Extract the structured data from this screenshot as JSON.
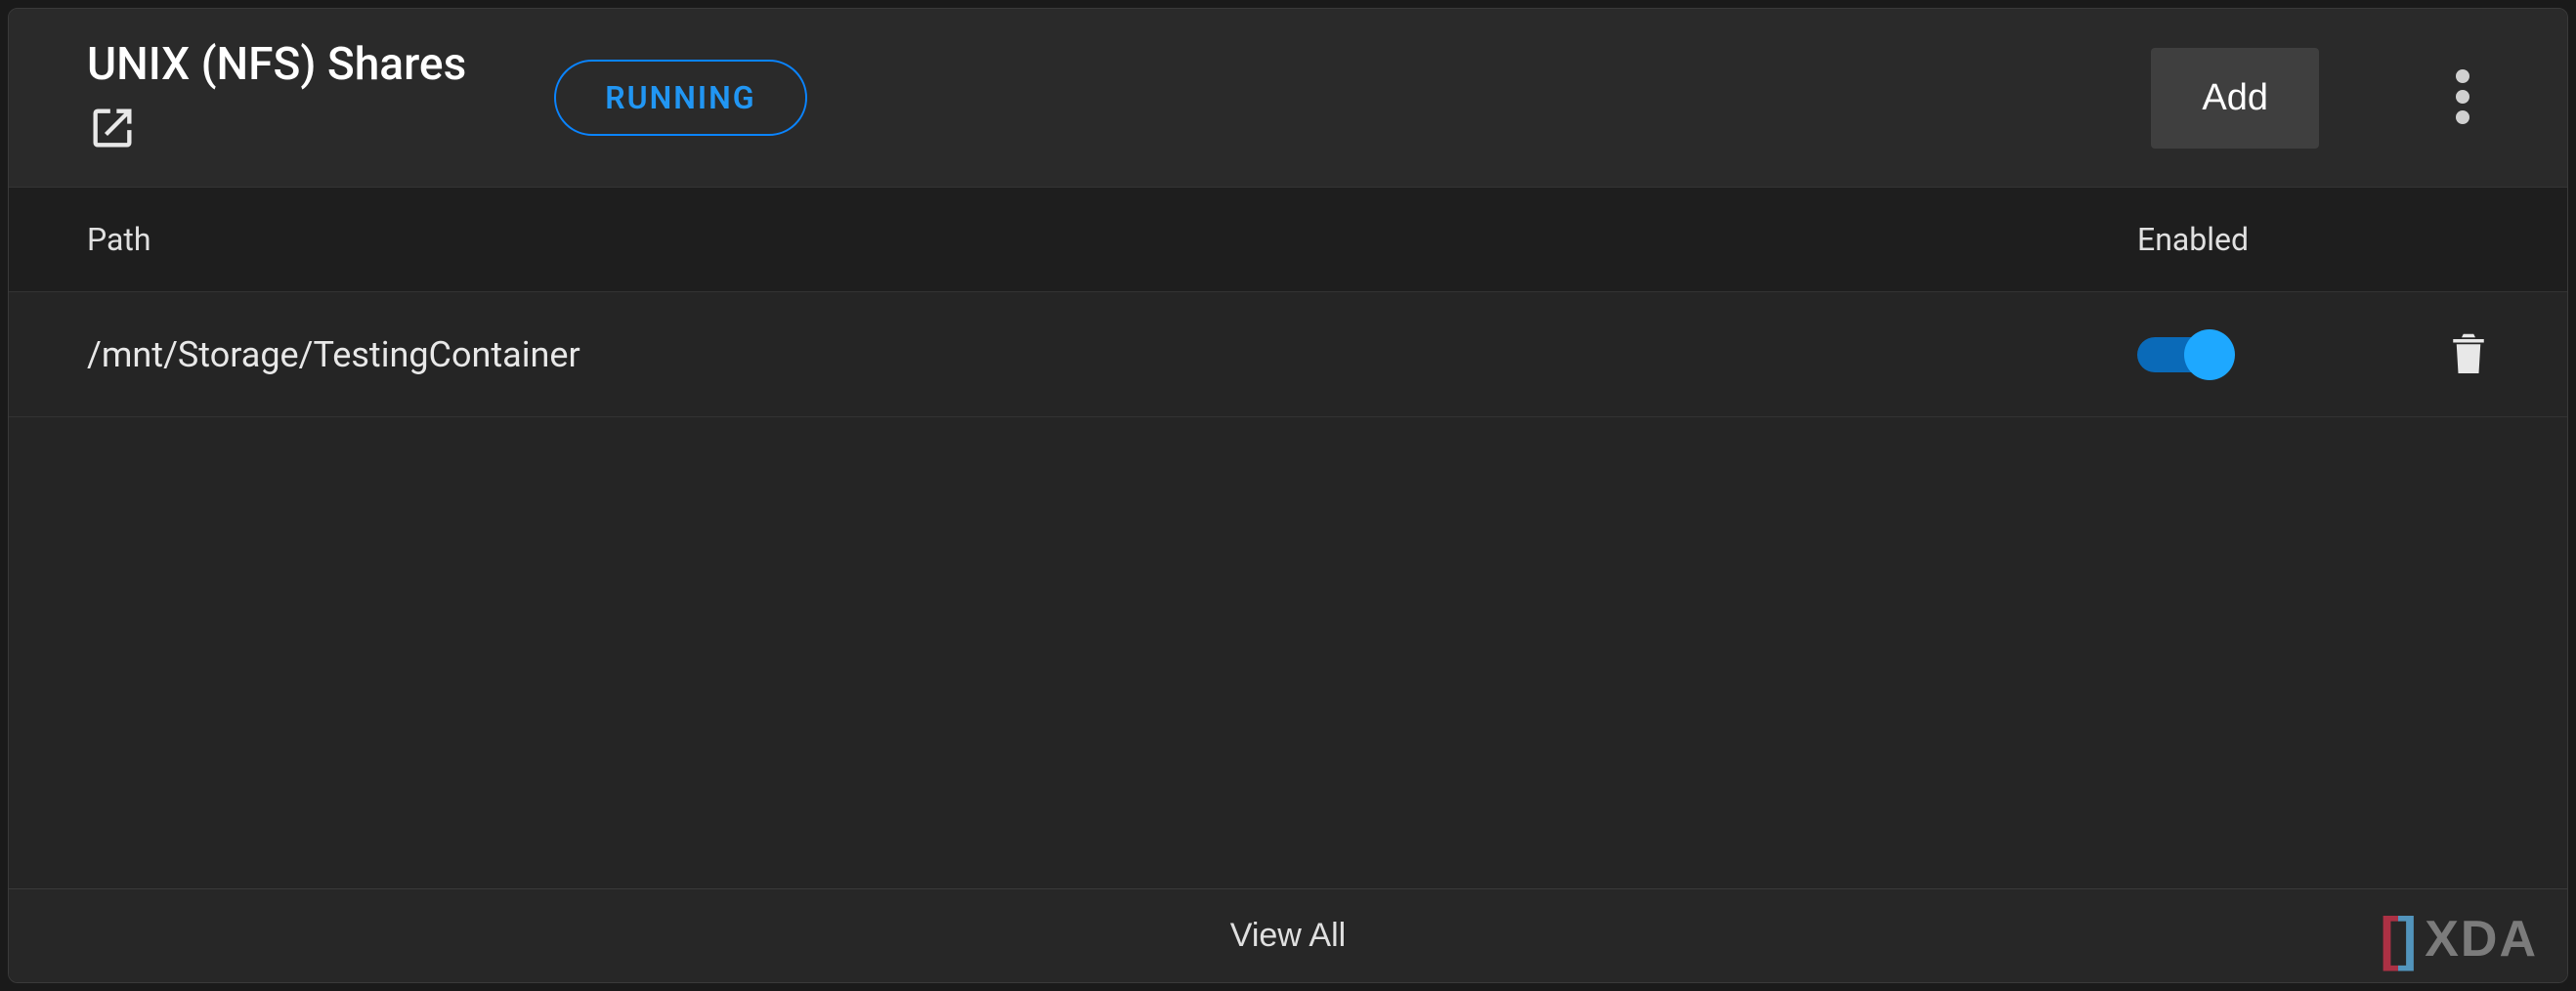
{
  "header": {
    "title": "UNIX (NFS) Shares",
    "status": "RUNNING",
    "add_label": "Add"
  },
  "table": {
    "columns": {
      "path": "Path",
      "enabled": "Enabled"
    },
    "rows": [
      {
        "path": "/mnt/Storage/TestingContainer",
        "enabled": true
      }
    ]
  },
  "footer": {
    "view_all_label": "View All"
  },
  "watermark": {
    "text": "XDA"
  }
}
